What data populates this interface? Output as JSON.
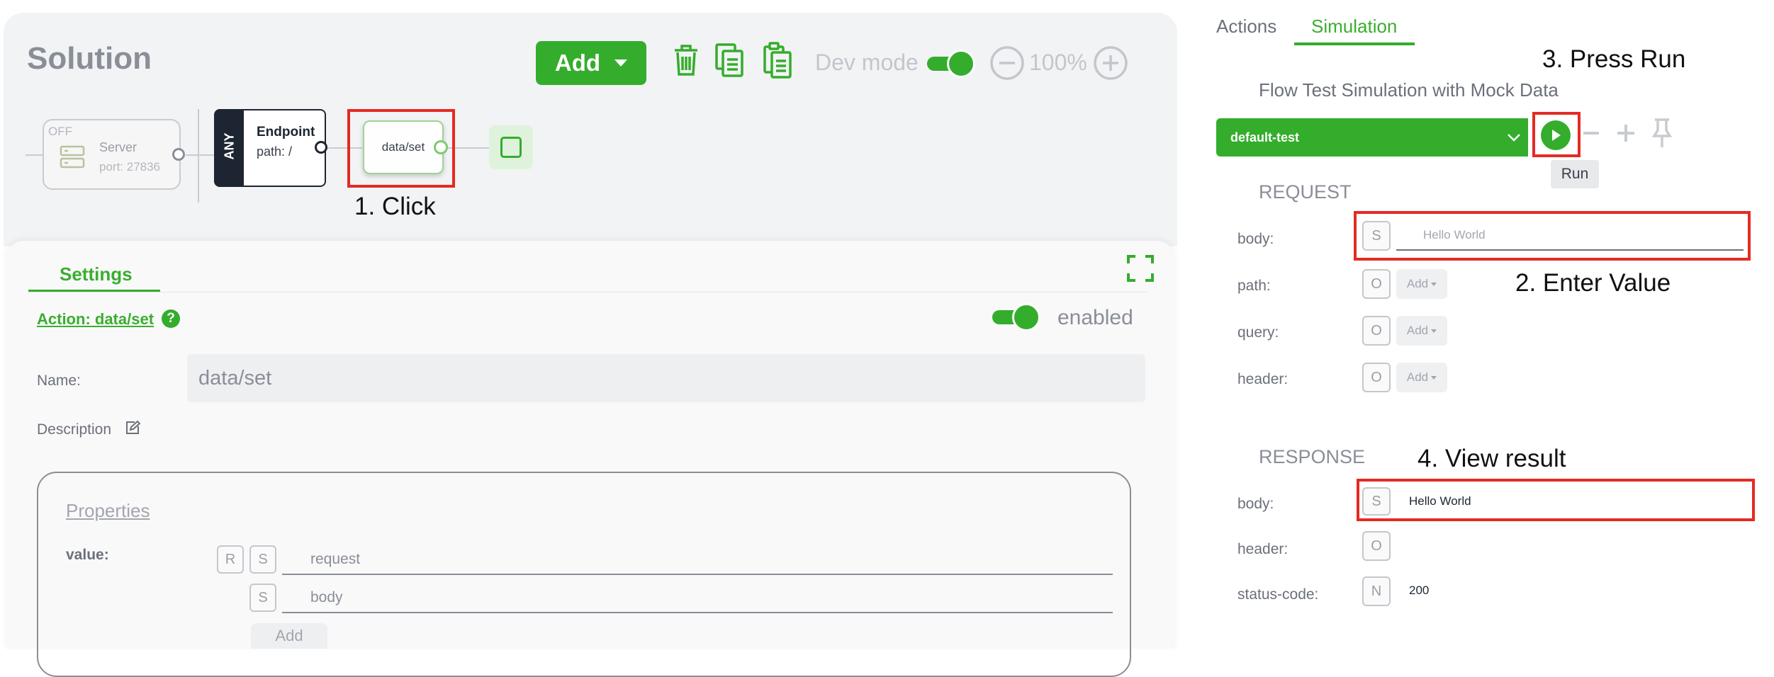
{
  "canvas": {
    "title": "Solution",
    "add_label": "Add",
    "dev_mode_label": "Dev mode",
    "zoom": "100%",
    "nodes": {
      "server": {
        "status": "OFF",
        "name": "Server",
        "port": "port: 27836"
      },
      "endpoint": {
        "method": "ANY",
        "name": "Endpoint",
        "path": "path: /"
      },
      "action": {
        "name": "data/set"
      }
    }
  },
  "settings": {
    "tab_label": "Settings",
    "action_link": "Action: data/set",
    "enabled_label": "enabled",
    "name_label": "Name:",
    "name_value": "data/set",
    "description_label": "Description",
    "properties_title": "Properties",
    "value_label": "value:",
    "badges": {
      "r": "R",
      "s": "S"
    },
    "value_rows": [
      "request",
      "body"
    ],
    "add_label": "Add"
  },
  "right": {
    "tabs": [
      "Actions",
      "Simulation"
    ],
    "sim_title": "Flow Test Simulation with Mock Data",
    "selected_test": "default-test",
    "tooltip": "Run",
    "request": {
      "heading": "REQUEST",
      "rows": [
        {
          "label": "body:",
          "badge": "S",
          "value": "Hello World"
        },
        {
          "label": "path:",
          "badge": "O",
          "add": "Add"
        },
        {
          "label": "query:",
          "badge": "O",
          "add": "Add"
        },
        {
          "label": "header:",
          "badge": "O",
          "add": "Add"
        }
      ]
    },
    "response": {
      "heading": "RESPONSE",
      "rows": [
        {
          "label": "body:",
          "badge": "S",
          "value": "Hello World"
        },
        {
          "label": "header:",
          "badge": "O"
        },
        {
          "label": "status-code:",
          "badge": "N",
          "value": "200"
        }
      ]
    }
  },
  "annotations": {
    "step1": "1. Click",
    "step2": "2. Enter Value",
    "step3": "3. Press Run",
    "step4": "4. View result"
  },
  "colors": {
    "accent": "#34ad2c",
    "highlight": "#e32b23",
    "node_dark": "#1d2532"
  }
}
